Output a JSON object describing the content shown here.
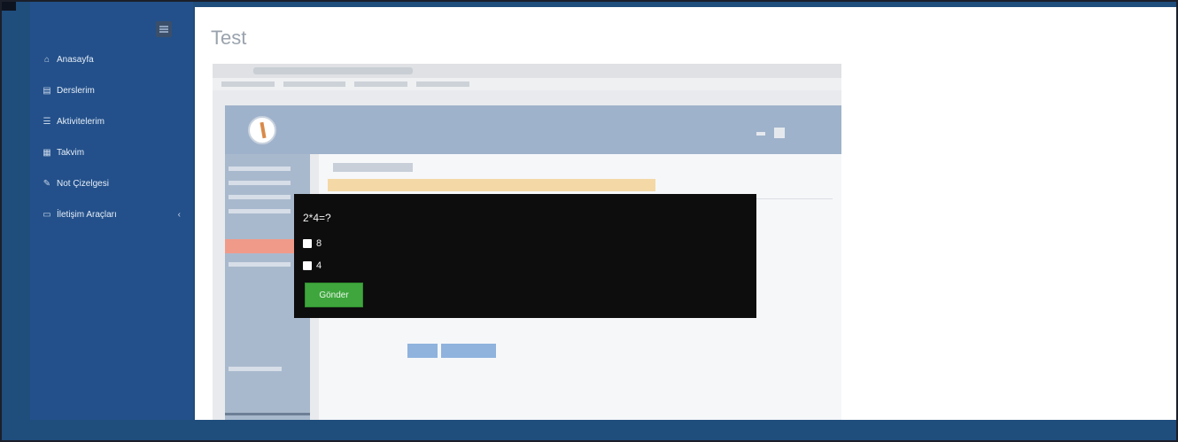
{
  "sidebar": {
    "items": [
      {
        "label": "Anasayfa",
        "icon": "home-icon"
      },
      {
        "label": "Derslerim",
        "icon": "book-icon"
      },
      {
        "label": "Aktivitelerim",
        "icon": "list-icon"
      },
      {
        "label": "Takvim",
        "icon": "calendar-icon"
      },
      {
        "label": "Not Çizelgesi",
        "icon": "pencil-icon"
      },
      {
        "label": "İletişim Araçları",
        "icon": "chat-icon"
      }
    ]
  },
  "main": {
    "title": "Test"
  },
  "quiz": {
    "question": "2*4=?",
    "options": [
      {
        "label": "8"
      },
      {
        "label": "4"
      }
    ],
    "submit_label": "Gönder"
  },
  "colors": {
    "sidebar_bg": "#23508a",
    "frame_bg": "#1f4d7c",
    "submit_green": "#3ea63c",
    "overlay_black": "#0d0d0d"
  }
}
